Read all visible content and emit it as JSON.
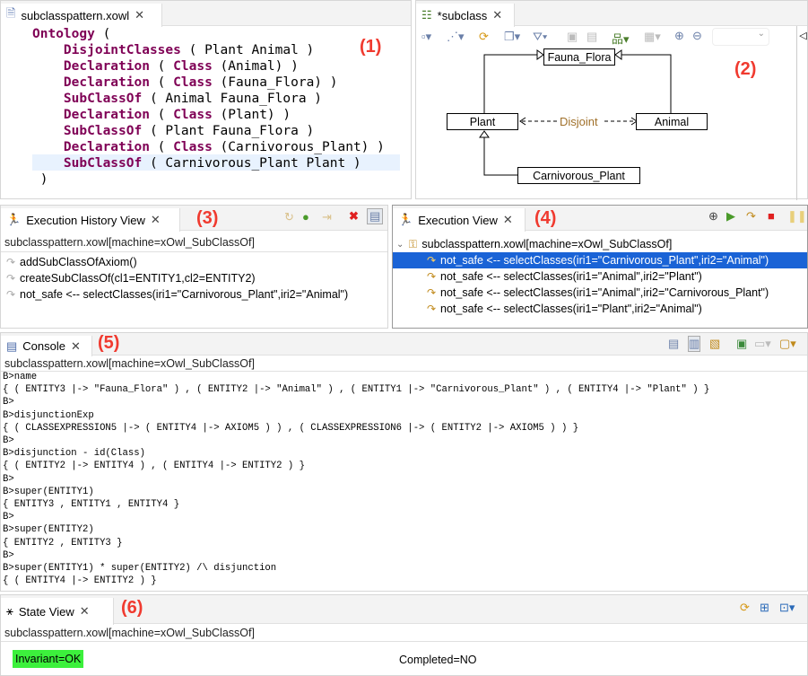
{
  "editor": {
    "tab": "subclasspattern.xowl",
    "marker": "(1)",
    "lines": [
      {
        "kw": "Ontology",
        "rest": " (",
        "indent": 0
      },
      {
        "kw": "DisjointClasses",
        "rest": " ( Plant Animal )",
        "indent": 1
      },
      {
        "kw": "Declaration",
        "mid": " ( ",
        "kw2": "Class",
        "rest": " (Animal) )",
        "indent": 1
      },
      {
        "kw": "Declaration",
        "mid": " ( ",
        "kw2": "Class",
        "rest": " (Fauna_Flora) )",
        "indent": 1
      },
      {
        "kw": "SubClassOf",
        "rest": " ( Animal Fauna_Flora )",
        "indent": 1
      },
      {
        "kw": "Declaration",
        "mid": " ( ",
        "kw2": "Class",
        "rest": " (Plant) )",
        "indent": 1
      },
      {
        "kw": "SubClassOf",
        "rest": " ( Plant Fauna_Flora )",
        "indent": 1
      },
      {
        "kw": "Declaration",
        "mid": " ( ",
        "kw2": "Class",
        "rest": " (Carnivorous_Plant) )",
        "indent": 1
      },
      {
        "kw": "SubClassOf",
        "rest": " ( Carnivorous_Plant Plant )",
        "indent": 1,
        "highlight": true
      },
      {
        "kw": "",
        "rest": " )",
        "indent": 0
      }
    ]
  },
  "diagram": {
    "tab": "*subclass",
    "marker": "(2)",
    "nodes": {
      "fauna": "Fauna_Flora",
      "plant": "Plant",
      "animal": "Animal",
      "carn": "Carnivorous_Plant"
    },
    "edge_label": "Disjoint",
    "edge_label_color": "#a0702a"
  },
  "history": {
    "tab": "Execution History View",
    "marker": "(3)",
    "subtitle": "subclasspattern.xowl[machine=xOwl_SubClassOf]",
    "items": [
      "addSubClassOfAxiom()",
      "createSubClassOf(cl1=ENTITY1,cl2=ENTITY2)",
      "not_safe <-- selectClasses(iri1=\"Carnivorous_Plant\",iri2=\"Animal\")"
    ]
  },
  "execution": {
    "tab": "Execution View",
    "marker": "(4)",
    "root": "subclasspattern.xowl[machine=xOwl_SubClassOf]",
    "selection_color": "#1a63d6",
    "items": [
      "not_safe <-- selectClasses(iri1=\"Carnivorous_Plant\",iri2=\"Animal\")",
      "not_safe <-- selectClasses(iri1=\"Animal\",iri2=\"Plant\")",
      "not_safe <-- selectClasses(iri1=\"Animal\",iri2=\"Carnivorous_Plant\")",
      "not_safe <-- selectClasses(iri1=\"Plant\",iri2=\"Animal\")"
    ]
  },
  "console": {
    "tab": "Console",
    "marker": "(5)",
    "subtitle": "subclasspattern.xowl[machine=xOwl_SubClassOf]",
    "lines": [
      "B>name",
      "{ ( ENTITY3 |-> \"Fauna_Flora\" ) , ( ENTITY2 |-> \"Animal\" ) , ( ENTITY1 |-> \"Carnivorous_Plant\" ) , ( ENTITY4 |-> \"Plant\" ) }",
      "B>",
      "B>disjunctionExp",
      "{ ( CLASSEXPRESSION5 |-> ( ENTITY4 |-> AXIOM5 ) ) , ( CLASSEXPRESSION6 |-> ( ENTITY2 |-> AXIOM5 ) ) }",
      "B>",
      "B>disjunction - id(Class)",
      "{ ( ENTITY2 |-> ENTITY4 ) , ( ENTITY4 |-> ENTITY2 ) }",
      "B>",
      "B>super(ENTITY1)",
      "{ ENTITY3 , ENTITY1 , ENTITY4 }",
      "B>",
      "B>super(ENTITY2)",
      "{ ENTITY2 , ENTITY3 }",
      "B>",
      "B>super(ENTITY1) * super(ENTITY2) /\\ disjunction",
      "{ ( ENTITY4 |-> ENTITY2 ) }"
    ]
  },
  "state": {
    "tab": "State View",
    "marker": "(6)",
    "subtitle": "subclasspattern.xowl[machine=xOwl_SubClassOf]",
    "invariant": "Invariant=OK",
    "invariant_color": "#3cf03c",
    "completed": "Completed=NO"
  }
}
